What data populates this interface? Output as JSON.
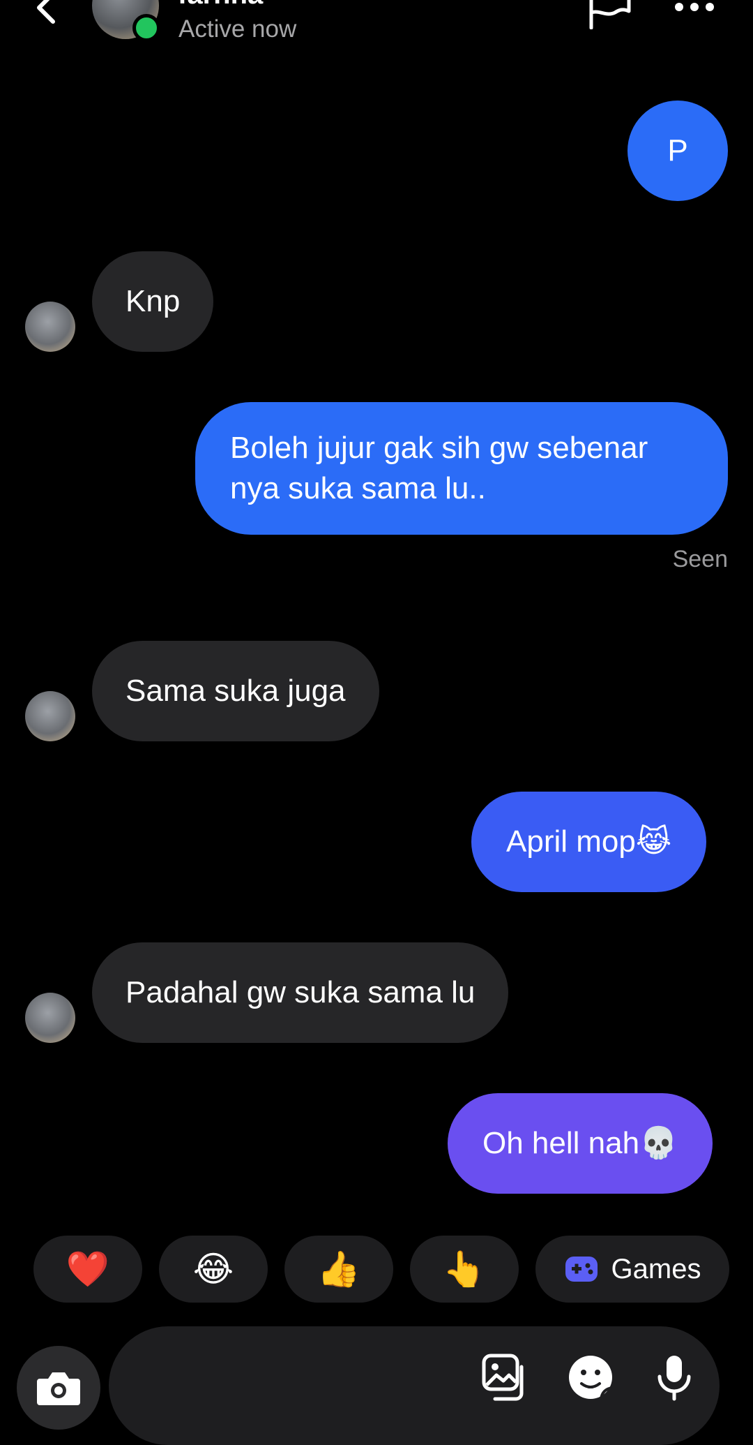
{
  "header": {
    "contact_name": "farhha",
    "status": "Active now"
  },
  "messages": [
    {
      "id": "m1",
      "side": "out",
      "text": "P"
    },
    {
      "id": "m2",
      "side": "in",
      "text": "Knp"
    },
    {
      "id": "m3",
      "side": "out",
      "lines": [
        "Boleh jujur gak sih gw sebenar",
        "nya suka sama lu.."
      ]
    },
    {
      "id": "m4",
      "side": "in",
      "text": "Sama suka juga"
    },
    {
      "id": "m5",
      "side": "out",
      "text": "April mop😹"
    },
    {
      "id": "m6",
      "side": "in",
      "text": "Padahal gw suka sama lu"
    },
    {
      "id": "m7",
      "side": "out",
      "text": "Oh hell nah💀"
    }
  ],
  "seen_label": "Seen",
  "quick_reactions": [
    "❤️",
    "😂",
    "👍",
    "👆"
  ],
  "games_label": "Games",
  "colors": {
    "outgoing_bubble": "#2b6cf7",
    "outgoing_bubble_purple": "#6a4ff0",
    "incoming_bubble": "#262628",
    "online": "#22c55e",
    "background": "#000000"
  },
  "icons": {
    "header": [
      "back-arrow-icon",
      "flag-icon",
      "more-icon"
    ],
    "composer": [
      "camera-icon",
      "gallery-icon",
      "sticker-icon",
      "microphone-icon"
    ]
  }
}
